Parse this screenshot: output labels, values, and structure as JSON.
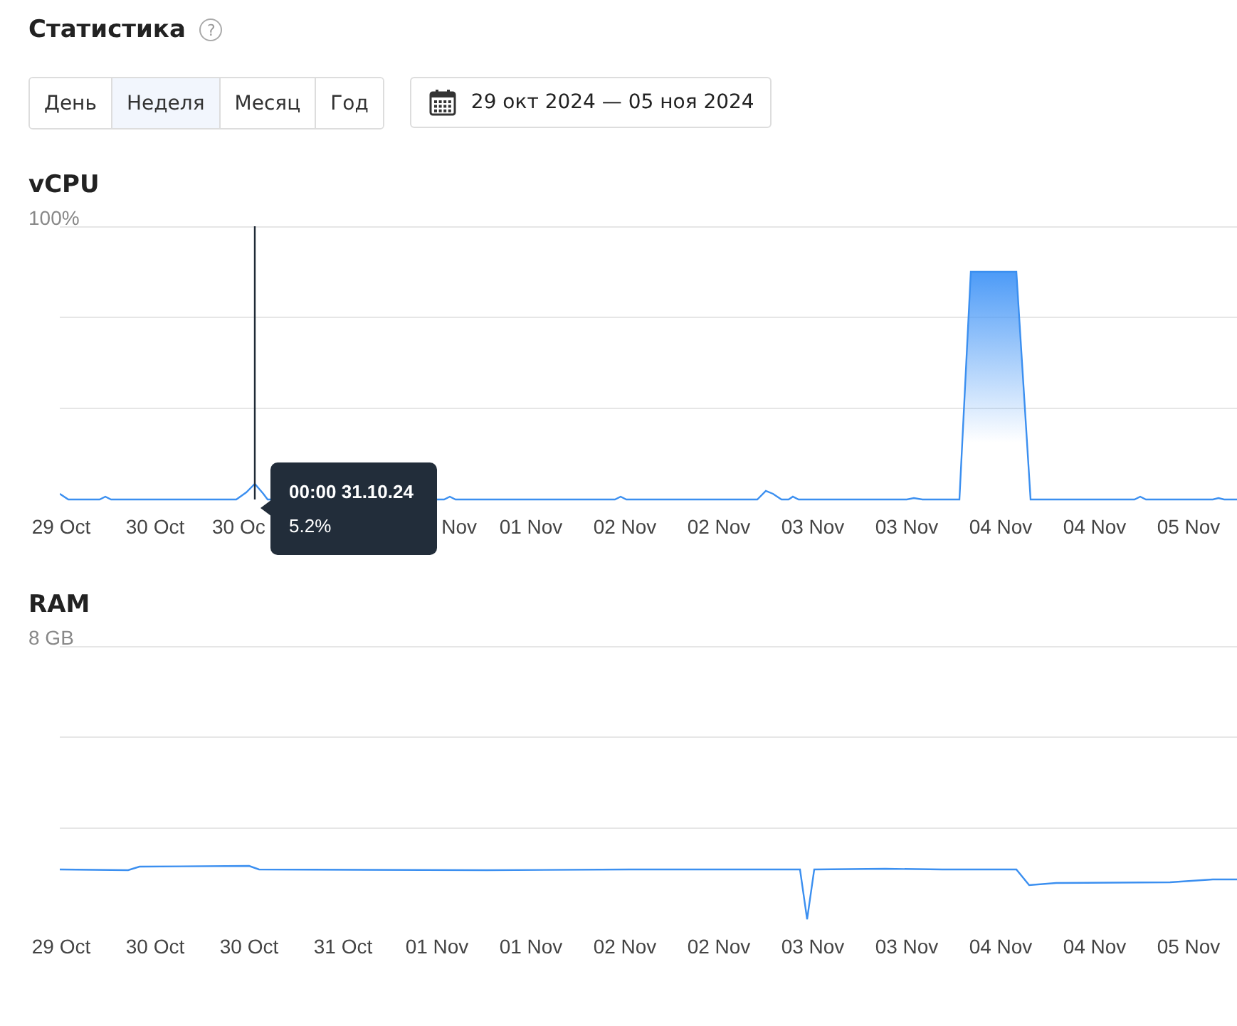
{
  "header": {
    "title": "Статистика",
    "help": "?"
  },
  "periods": [
    {
      "label": "День",
      "selected": false
    },
    {
      "label": "Неделя",
      "selected": true
    },
    {
      "label": "Месяц",
      "selected": false
    },
    {
      "label": "Год",
      "selected": false
    }
  ],
  "date_range": {
    "label": "29 окт 2024 — 05 ноя 2024"
  },
  "charts": [
    {
      "kind": "cpu",
      "title": "vCPU",
      "y_max_label": "100%",
      "x_labels": [
        {
          "text": "29 Oct",
          "kind": "full"
        },
        {
          "text": "30 Oct",
          "kind": "full"
        },
        {
          "text": "30 Oc",
          "kind": "cut-end"
        },
        {
          "text": "Nov",
          "kind": "cut-start"
        },
        {
          "text": "01 Nov",
          "kind": "full"
        },
        {
          "text": "02 Nov",
          "kind": "full"
        },
        {
          "text": "02 Nov",
          "kind": "full"
        },
        {
          "text": "03 Nov",
          "kind": "full"
        },
        {
          "text": "03 Nov",
          "kind": "full"
        },
        {
          "text": "04 Nov",
          "kind": "full"
        },
        {
          "text": "04 Nov",
          "kind": "full"
        },
        {
          "text": "05 Nov",
          "kind": "full"
        }
      ],
      "tooltip": {
        "time": "00:00 31.10.24",
        "value": "5.2%"
      }
    },
    {
      "kind": "ram",
      "title": "RAM",
      "y_max_label": "8 GB",
      "x_labels": [
        {
          "text": "29 Oct",
          "kind": "full"
        },
        {
          "text": "30 Oct",
          "kind": "full"
        },
        {
          "text": "30 Oct",
          "kind": "full"
        },
        {
          "text": "31 Oct",
          "kind": "full"
        },
        {
          "text": "01 Nov",
          "kind": "full"
        },
        {
          "text": "01 Nov",
          "kind": "full"
        },
        {
          "text": "02 Nov",
          "kind": "full"
        },
        {
          "text": "02 Nov",
          "kind": "full"
        },
        {
          "text": "03 Nov",
          "kind": "full"
        },
        {
          "text": "03 Nov",
          "kind": "full"
        },
        {
          "text": "04 Nov",
          "kind": "full"
        },
        {
          "text": "04 Nov",
          "kind": "full"
        },
        {
          "text": "05 Nov",
          "kind": "full"
        }
      ]
    }
  ]
}
